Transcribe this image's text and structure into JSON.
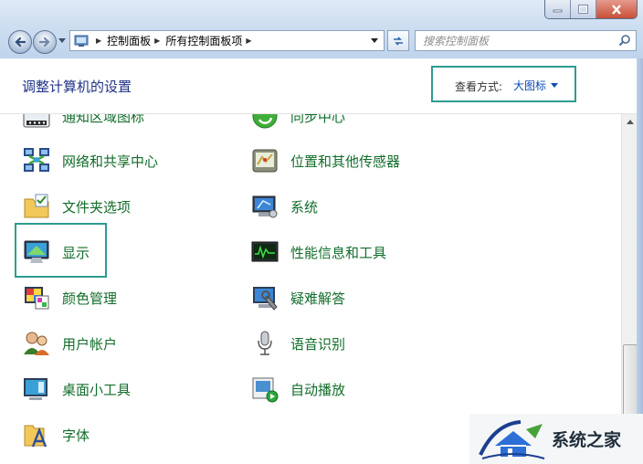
{
  "window": {
    "address": {
      "breadcrumbs": [
        "控制面板",
        "所有控制面板项"
      ]
    },
    "search": {
      "placeholder": "搜索控制面板"
    }
  },
  "header": {
    "title": "调整计算机的设置",
    "view_by_label": "查看方式:",
    "view_by_value": "大图标"
  },
  "items": {
    "notification": "通知区域图标",
    "sync": "同步中心",
    "network": "网络和共享中心",
    "location": "位置和其他传感器",
    "folder": "文件夹选项",
    "system": "系统",
    "display": "显示",
    "performance": "性能信息和工具",
    "color": "颜色管理",
    "troubleshoot": "疑难解答",
    "users": "用户帐户",
    "speech": "语音识别",
    "gadgets": "桌面小工具",
    "autoplay": "自动播放",
    "fonts": "字体"
  },
  "colors": {
    "link_green": "#116d2a",
    "title_blue": "#1e3287",
    "highlight_teal": "#2d9c90"
  },
  "watermark": {
    "text": "系统之家"
  }
}
